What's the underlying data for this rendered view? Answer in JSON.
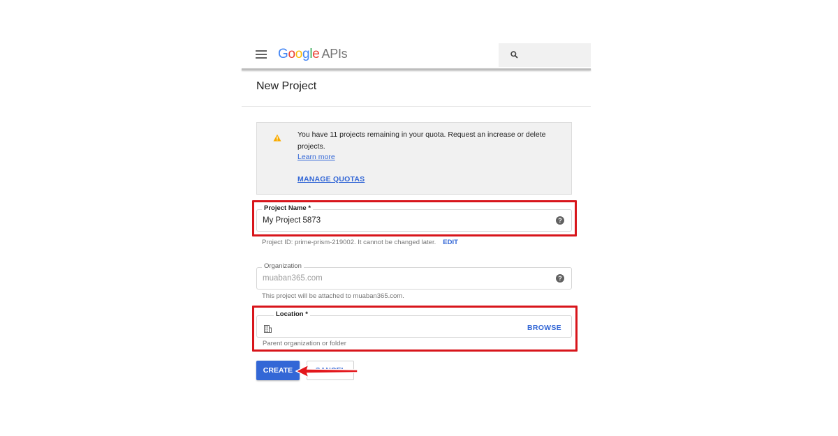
{
  "header": {
    "logo_letters": [
      "G",
      "o",
      "o",
      "g",
      "l",
      "e"
    ],
    "logo_suffix": "APIs",
    "search_icon": "search-icon",
    "menu_icon": "hamburger-menu-icon"
  },
  "page": {
    "title": "New Project"
  },
  "notice": {
    "icon": "warning-icon",
    "message": "You have 11 projects remaining in your quota. Request an increase or delete projects.",
    "learn_more": "Learn more",
    "manage_quotas": "MANAGE QUOTAS"
  },
  "project_name": {
    "label": "Project Name  *",
    "value": "My Project 5873",
    "id_hint": "Project ID: prime-prism-219002. It cannot be changed later.",
    "edit_label": "EDIT"
  },
  "organization": {
    "label": "Organization",
    "value": "muaban365.com",
    "hint": "This project will be attached to muaban365.com."
  },
  "location": {
    "label": "Location *",
    "browse_label": "BROWSE",
    "hint": "Parent organization or folder"
  },
  "actions": {
    "create_label": "CREATE",
    "cancel_label": "CANCEL"
  },
  "colors": {
    "accent": "#3367d6",
    "highlight": "#d8151b",
    "warning": "#f9ab00"
  }
}
